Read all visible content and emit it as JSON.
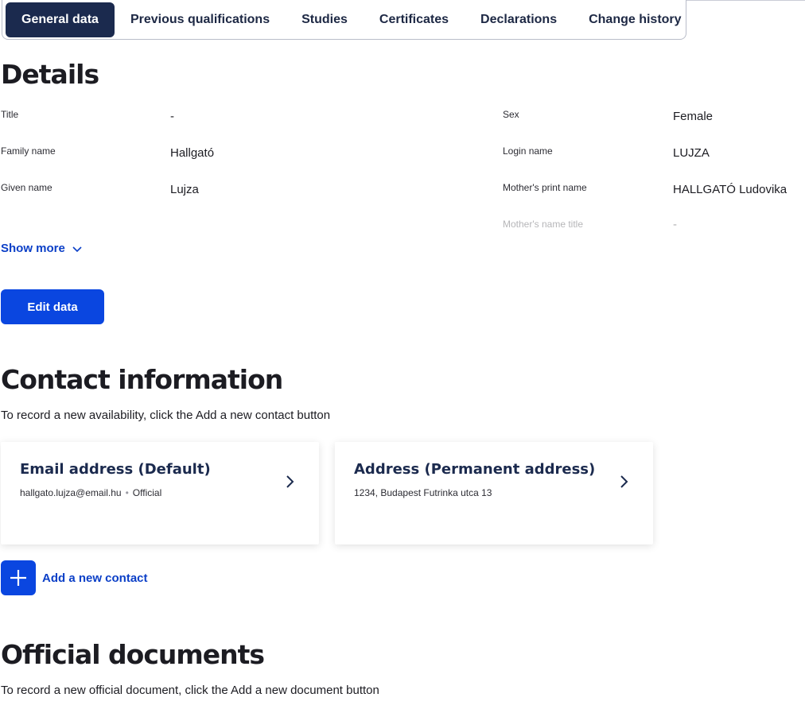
{
  "tabs": [
    {
      "label": "General data",
      "active": true
    },
    {
      "label": "Previous qualifications"
    },
    {
      "label": "Studies"
    },
    {
      "label": "Certificates"
    },
    {
      "label": "Declarations"
    },
    {
      "label": "Change history"
    }
  ],
  "details": {
    "heading": "Details",
    "left": [
      {
        "label": "Title",
        "value": "-"
      },
      {
        "label": "Family name",
        "value": "Hallgató"
      },
      {
        "label": "Given name",
        "value": "Lujza"
      }
    ],
    "right": [
      {
        "label": "Sex",
        "value": "Female"
      },
      {
        "label": "Login name",
        "value": "LUJZA"
      },
      {
        "label": "Mother's print name",
        "value": "HALLGATÓ Ludovika"
      },
      {
        "label": "Mother's name title",
        "value": "-"
      }
    ],
    "show_more": "Show more",
    "edit_button": "Edit data"
  },
  "contact": {
    "heading": "Contact information",
    "helper": "To record a new availability, click the Add a new contact button",
    "cards": [
      {
        "title": "Email address (Default)",
        "value": "hallgato.lujza@email.hu",
        "tag": "Official"
      },
      {
        "title": "Address (Permanent address)",
        "value": "1234, Budapest Futrinka utca 13"
      }
    ],
    "add_label": "Add a new contact"
  },
  "official": {
    "heading": "Official documents",
    "helper": "To record a new official document, click the Add a new document button"
  },
  "colors": {
    "primary": "#0a46e0",
    "tab_active": "#1b2a4e",
    "link": "#0b3fc7"
  }
}
